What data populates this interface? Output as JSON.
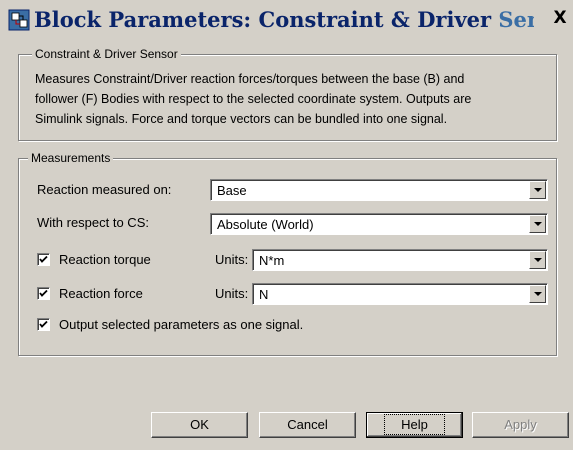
{
  "window": {
    "title_part1": "Block Parameters: Constraint & Driver ",
    "title_part2": "Sensor",
    "close_glyph": "X"
  },
  "block_group": {
    "legend": "Constraint & Driver Sensor",
    "description_lines": [
      "Measures Constraint/Driver reaction forces/torques between the base (B) and",
      "follower (F) Bodies with respect to the selected coordinate system. Outputs are",
      "Simulink signals. Force and torque vectors can be bundled into one signal."
    ]
  },
  "measurements": {
    "legend": "Measurements",
    "reaction_measured_on": {
      "label": "Reaction measured on:",
      "value": "Base"
    },
    "with_respect_to": {
      "label": "With respect to CS:",
      "value": "Absolute (World)"
    },
    "reaction_torque": {
      "label": "Reaction torque",
      "checked": true,
      "units_label": "Units:",
      "units_value": "N*m"
    },
    "reaction_force": {
      "label": "Reaction force",
      "checked": true,
      "units_label": "Units:",
      "units_value": "N"
    },
    "output_one_signal": {
      "label": "Output selected parameters as one signal.",
      "checked": true
    }
  },
  "buttons": {
    "ok": "OK",
    "cancel": "Cancel",
    "help": "Help",
    "apply": "Apply"
  },
  "colors": {
    "face": "#d4d0c8",
    "title_text": "#0a246a",
    "title_text_light": "#3a6ea5"
  },
  "icons": {
    "app": "simulink-block-icon",
    "close": "close-icon",
    "dropdown": "chevron-down-icon",
    "check": "checkmark-icon"
  }
}
